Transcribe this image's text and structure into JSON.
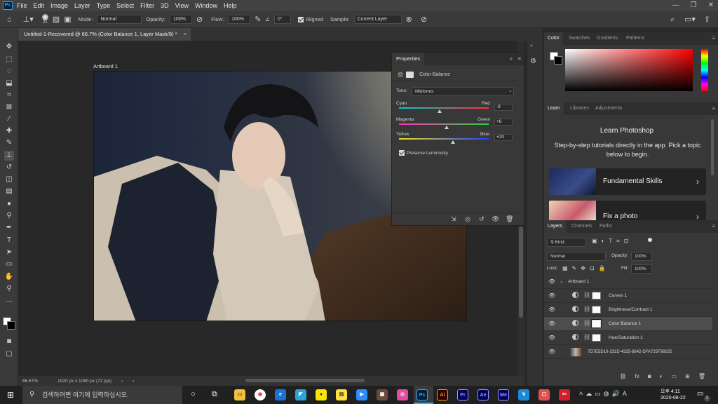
{
  "app": {
    "logo": "Ps",
    "accent": "#31a8ff"
  },
  "menu": [
    "File",
    "Edit",
    "Image",
    "Layer",
    "Type",
    "Select",
    "Filter",
    "3D",
    "View",
    "Window",
    "Help"
  ],
  "options": {
    "brush_size": "21",
    "mode_label": "Mode:",
    "mode_value": "Normal",
    "opacity_label": "Opacity:",
    "opacity_value": "100%",
    "flow_label": "Flow:",
    "flow_value": "100%",
    "angle_value": "0°",
    "aligned_label": "Aligned",
    "sample_label": "Sample:",
    "sample_value": "Current Layer"
  },
  "document": {
    "tab_title": "Untitled-1-Recovered @ 66.7% (Color Balance 1, Layer Mask/8) *",
    "artboard_label": "Artboard 1",
    "zoom": "66.67%",
    "doc_info": "1920 px x 1080 px (72 ppi)"
  },
  "properties": {
    "title": "Properties",
    "adjustment_name": "Color Balance",
    "tone_label": "Tone:",
    "tone_value": "Midtones",
    "sliders": [
      {
        "left": "Cyan",
        "right": "Red",
        "value": "-9",
        "pos": 0.455
      },
      {
        "left": "Magenta",
        "right": "Green",
        "value": "+6",
        "pos": 0.53
      },
      {
        "left": "Yellow",
        "right": "Blue",
        "value": "+20",
        "pos": 0.6
      }
    ],
    "preserve_label": "Preserve Luminosity"
  },
  "panels": {
    "color_tabs": [
      "Color",
      "Swatches",
      "Gradients",
      "Patterns"
    ],
    "learn_tabs": [
      "Learn",
      "Libraries",
      "Adjustments"
    ],
    "learn_title": "Learn Photoshop",
    "learn_desc": "Step-by-step tutorials directly in the app. Pick a topic below to begin.",
    "learn_cards": [
      "Fundamental Skills",
      "Fix a photo"
    ],
    "layer_tabs": [
      "Layers",
      "Channels",
      "Paths"
    ],
    "layers_filter": "Kind",
    "blend_mode": "Normal",
    "opacity_label": "Opacity:",
    "opacity_value": "100%",
    "lock_label": "Lock:",
    "fill_label": "Fill:",
    "fill_value": "100%",
    "layers": [
      {
        "name": "Artboard 1"
      },
      {
        "name": "Curves 1"
      },
      {
        "name": "Brightness/Contrast 1"
      },
      {
        "name": "Color Balance 1"
      },
      {
        "name": "Hue/Saturation 1"
      },
      {
        "name": "7D7E5D10-331D-4325-8642-DFA725F96025"
      }
    ]
  },
  "taskbar": {
    "search_placeholder": "검색하려면 여기에 입력하십시오.",
    "time": "오후 4:11",
    "date": "2020-08-22",
    "notif_count": "2"
  }
}
